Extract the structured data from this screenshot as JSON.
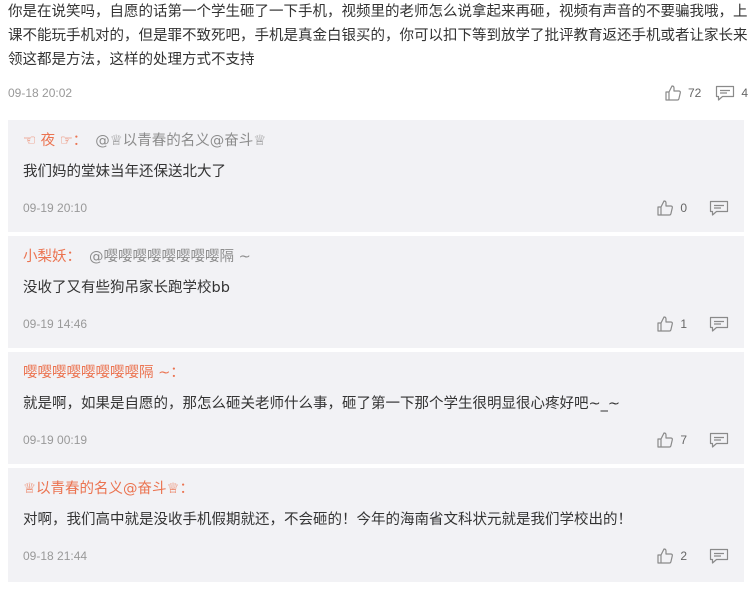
{
  "main": {
    "text": "你是在说笑吗，自愿的话第一个学生砸了一下手机，视频里的老师怎么说拿起来再砸，视频有声音的不要骗我哦，上课不能玩手机对的，但是罪不致死吧，手机是真金白银买的，你可以扣下等到放学了批评教育返还手机或者让家长来领这都是方法，这样的处理方式不支持",
    "time": "09-18 20:02",
    "likes": "72",
    "replies": "4"
  },
  "replies": [
    {
      "author": "☜ 夜 ☞",
      "colon": "：",
      "mention": "@♕以青春的名义@奋斗♕",
      "text": "我们妈的堂妹当年还保送北大了",
      "time": "09-19 20:10",
      "likes": "0"
    },
    {
      "author": "小梨妖",
      "colon": "：",
      "mention": "@嘤嘤嘤嘤嘤嘤嘤嘤隔 ~",
      "text": "没收了又有些狗吊家长跑学校bb",
      "time": "09-19 14:46",
      "likes": "1"
    },
    {
      "author": "嘤嘤嘤嘤嘤嘤嘤嘤隔 ~",
      "colon": "：",
      "mention": "",
      "text": "就是啊，如果是自愿的，那怎么砸关老师什么事，砸了第一下那个学生很明显很心疼好吧~_~",
      "time": "09-19 00:19",
      "likes": "7"
    },
    {
      "author": "♕以青春的名义@奋斗♕",
      "colon": "：",
      "mention": "",
      "text": "对啊，我们高中就是没收手机假期就还，不会砸的！今年的海南省文科状元就是我们学校出的！",
      "time": "09-18 21:44",
      "likes": "2"
    }
  ],
  "colors": {
    "author": "#eb7350",
    "mention": "#8c8c8c",
    "reply_bg": "#f2f2f5",
    "time": "#999999"
  }
}
